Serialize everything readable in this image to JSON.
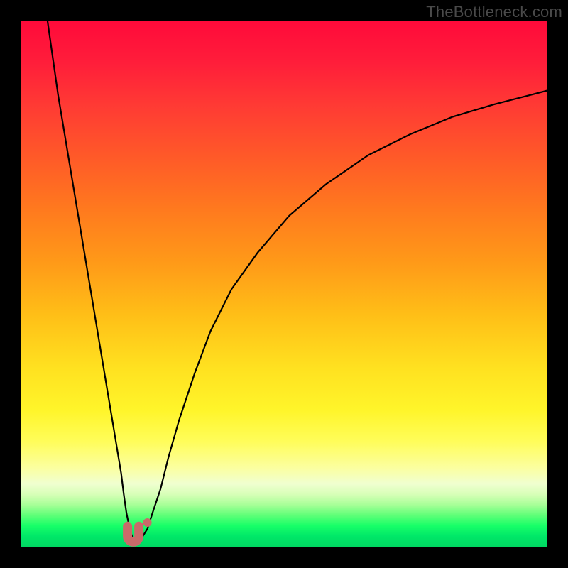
{
  "watermark": {
    "text": "TheBottleneck.com"
  },
  "chart_data": {
    "type": "line",
    "title": "",
    "xlabel": "",
    "ylabel": "",
    "xlim": [
      0,
      100
    ],
    "ylim": [
      0,
      100
    ],
    "grid": false,
    "legend": false,
    "series": [
      {
        "name": "left-curve",
        "color": "#000000",
        "x": [
          5,
          6,
          7,
          9,
          11,
          13,
          15,
          17,
          18,
          19,
          19.5,
          20,
          20.5,
          21,
          21.5,
          22,
          22.5,
          23
        ],
        "y": [
          100,
          93,
          86,
          74,
          62,
          50,
          38,
          26,
          20,
          14,
          10,
          6.5,
          4,
          2.2,
          1.2,
          0.8,
          1.0,
          1.8
        ]
      },
      {
        "name": "right-curve",
        "color": "#000000",
        "x": [
          23,
          24,
          25,
          26.5,
          28,
          30,
          33,
          36,
          40,
          45,
          51,
          58,
          66,
          74,
          82,
          90,
          97,
          100
        ],
        "y": [
          1.8,
          3.4,
          6.5,
          11,
          17,
          24,
          33,
          41,
          49,
          56,
          63,
          69,
          74.5,
          78.5,
          81.8,
          84.2,
          86,
          86.8
        ]
      }
    ],
    "markers": [
      {
        "name": "u-shape",
        "shape": "u",
        "x": 21.3,
        "y": 2.0,
        "color": "#c96a6a",
        "size": 22
      },
      {
        "name": "dot",
        "shape": "dot",
        "x": 24.0,
        "y": 4.6,
        "color": "#c96a6a",
        "size": 12
      }
    ],
    "gradient_stops": [
      {
        "pos": 0,
        "color": "#ff0a3a"
      },
      {
        "pos": 50,
        "color": "#ffbf17"
      },
      {
        "pos": 75,
        "color": "#fff52a"
      },
      {
        "pos": 100,
        "color": "#00d862"
      }
    ]
  }
}
